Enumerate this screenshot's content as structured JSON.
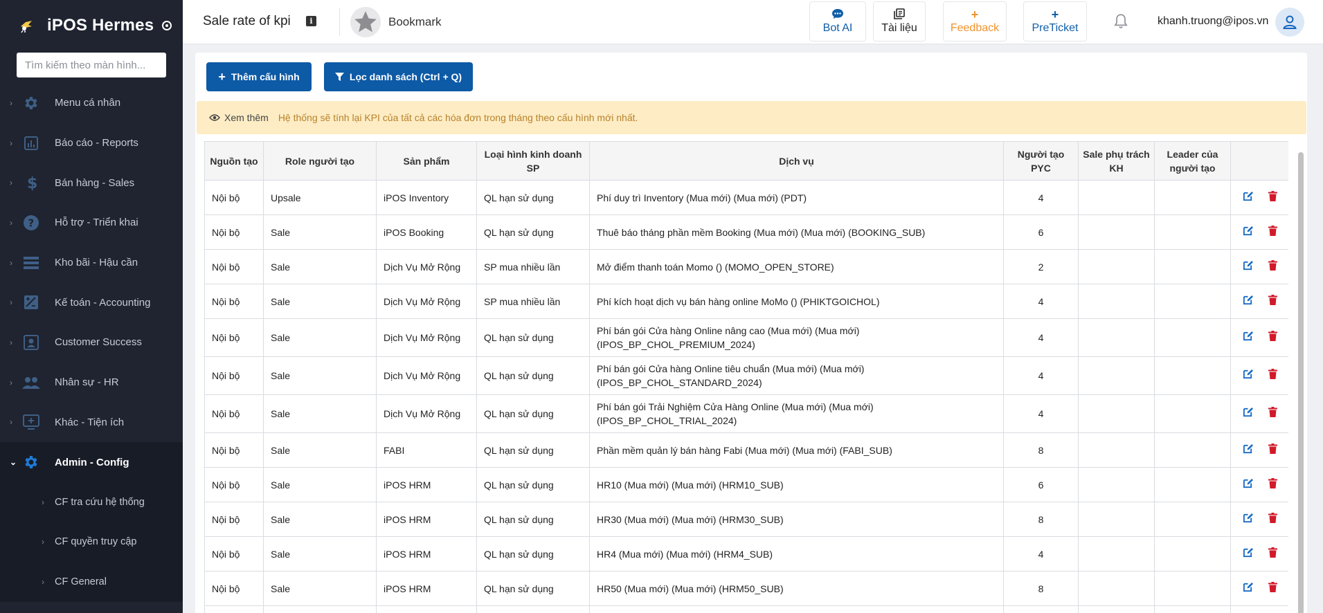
{
  "sidebar": {
    "app_name": "iPOS Hermes",
    "search_placeholder": "Tìm kiếm theo màn hình...",
    "items": [
      {
        "label": "Menu cá nhân",
        "icon": "gear-icon"
      },
      {
        "label": "Báo cáo - Reports",
        "icon": "report-chart-icon"
      },
      {
        "label": "Bán hàng - Sales",
        "icon": "dollar-icon"
      },
      {
        "label": "Hỗ trợ - Triển khai",
        "icon": "help-icon"
      },
      {
        "label": "Kho bãi - Hậu cần",
        "icon": "warehouse-list-icon"
      },
      {
        "label": "Kế toán - Accounting",
        "icon": "accounting-icon"
      },
      {
        "label": "Customer Success",
        "icon": "customer-success-icon"
      },
      {
        "label": "Nhân sự - HR",
        "icon": "people-icon"
      },
      {
        "label": "Khác - Tiện ích",
        "icon": "monitor-plus-icon"
      },
      {
        "label": "Admin - Config",
        "icon": "gear-icon",
        "active": true
      }
    ],
    "subitems": [
      {
        "label": "CF tra cứu hệ thống"
      },
      {
        "label": "CF quyền truy cập"
      },
      {
        "label": "CF General"
      }
    ]
  },
  "header": {
    "title": "Sale rate of kpi",
    "bookmark_label": "Bookmark",
    "tools": [
      {
        "label": "Bot AI",
        "icon": "chat-bubble-icon",
        "color": "#0f5ea8"
      },
      {
        "label": "Tài liệu",
        "icon": "document-icon",
        "color": "#222222"
      },
      {
        "label": "Feedback",
        "icon": "plus-icon",
        "color": "#f0932b"
      },
      {
        "label": "PreTicket",
        "icon": "plus-icon",
        "color": "#0f5ea8"
      }
    ],
    "user_email": "khanh.truong@ipos.vn"
  },
  "toolbar": {
    "add_label": "Thêm cấu hình",
    "filter_label": "Lọc danh sách (Ctrl + Q)"
  },
  "alert": {
    "more_label": "Xem thêm",
    "message": "Hệ thống sẽ tính lại KPI của tất cả các hóa đơn trong tháng theo cấu hình mới nhất."
  },
  "table": {
    "columns": [
      "Nguồn tạo",
      "Role người tạo",
      "Sản phẩm",
      "Loại hình kinh doanh SP",
      "Dịch vụ",
      "Người tạo PYC",
      "Sale phụ trách KH",
      "Leader của người tạo",
      ""
    ],
    "rows": [
      {
        "source": "Nội bộ",
        "role": "Upsale",
        "product": "iPOS Inventory",
        "type": "QL hạn sử dụng",
        "service": "Phí duy trì Inventory (Mua mới) (Mua mới) (PDT)",
        "pyc": "4",
        "sale": "",
        "leader": ""
      },
      {
        "source": "Nội bộ",
        "role": "Sale",
        "product": "iPOS Booking",
        "type": "QL hạn sử dụng",
        "service": "Thuê báo tháng phần mềm Booking (Mua mới) (Mua mới) (BOOKING_SUB)",
        "pyc": "6",
        "sale": "",
        "leader": ""
      },
      {
        "source": "Nội bộ",
        "role": "Sale",
        "product": "Dịch Vụ Mở Rộng",
        "type": "SP mua nhiều lần",
        "service": "Mở điểm thanh toán Momo () (MOMO_OPEN_STORE)",
        "pyc": "2",
        "sale": "",
        "leader": ""
      },
      {
        "source": "Nội bộ",
        "role": "Sale",
        "product": "Dịch Vụ Mở Rộng",
        "type": "SP mua nhiều lần",
        "service": "Phí kích hoạt dịch vụ bán hàng online MoMo () (PHIKTGOICHOL)",
        "pyc": "4",
        "sale": "",
        "leader": ""
      },
      {
        "source": "Nội bộ",
        "role": "Sale",
        "product": "Dịch Vụ Mở Rộng",
        "type": "QL hạn sử dụng",
        "service": "Phí bán gói Cửa hàng Online nâng cao (Mua mới) (Mua mới) (IPOS_BP_CHOL_PREMIUM_2024)",
        "pyc": "4",
        "sale": "",
        "leader": "",
        "tall": true
      },
      {
        "source": "Nội bộ",
        "role": "Sale",
        "product": "Dịch Vụ Mở Rộng",
        "type": "QL hạn sử dụng",
        "service": "Phí bán gói Cửa hàng Online tiêu chuẩn (Mua mới) (Mua mới) (IPOS_BP_CHOL_STANDARD_2024)",
        "pyc": "4",
        "sale": "",
        "leader": "",
        "tall": true
      },
      {
        "source": "Nội bộ",
        "role": "Sale",
        "product": "Dịch Vụ Mở Rộng",
        "type": "QL hạn sử dụng",
        "service": "Phí bán gói Trải Nghiệm Cửa Hàng Online (Mua mới) (Mua mới) (IPOS_BP_CHOL_TRIAL_2024)",
        "pyc": "4",
        "sale": "",
        "leader": "",
        "tall": true
      },
      {
        "source": "Nội bộ",
        "role": "Sale",
        "product": "FABI",
        "type": "QL hạn sử dụng",
        "service": "Phần mềm quản lý bán hàng Fabi (Mua mới) (Mua mới) (FABI_SUB)",
        "pyc": "8",
        "sale": "",
        "leader": ""
      },
      {
        "source": "Nội bộ",
        "role": "Sale",
        "product": "iPOS HRM",
        "type": "QL hạn sử dụng",
        "service": "HR10 (Mua mới) (Mua mới) (HRM10_SUB)",
        "pyc": "6",
        "sale": "",
        "leader": ""
      },
      {
        "source": "Nội bộ",
        "role": "Sale",
        "product": "iPOS HRM",
        "type": "QL hạn sử dụng",
        "service": "HR30 (Mua mới) (Mua mới) (HRM30_SUB)",
        "pyc": "8",
        "sale": "",
        "leader": ""
      },
      {
        "source": "Nội bộ",
        "role": "Sale",
        "product": "iPOS HRM",
        "type": "QL hạn sử dụng",
        "service": "HR4 (Mua mới) (Mua mới) (HRM4_SUB)",
        "pyc": "4",
        "sale": "",
        "leader": ""
      },
      {
        "source": "Nội bộ",
        "role": "Sale",
        "product": "iPOS HRM",
        "type": "QL hạn sử dụng",
        "service": "HR50 (Mua mới) (Mua mới) (HRM50_SUB)",
        "pyc": "8",
        "sale": "",
        "leader": ""
      },
      {
        "source": "",
        "role": "",
        "product": "",
        "type": "",
        "service": "",
        "pyc": "",
        "sale": "",
        "leader": ""
      }
    ]
  },
  "colors": {
    "sidebar_bg": "#1f2430",
    "primary": "#0d5aa6",
    "alert_bg": "#fdecc4",
    "alert_text": "#b7822a",
    "edit_icon": "#1a6cc4",
    "delete_icon": "#d11a2a"
  }
}
